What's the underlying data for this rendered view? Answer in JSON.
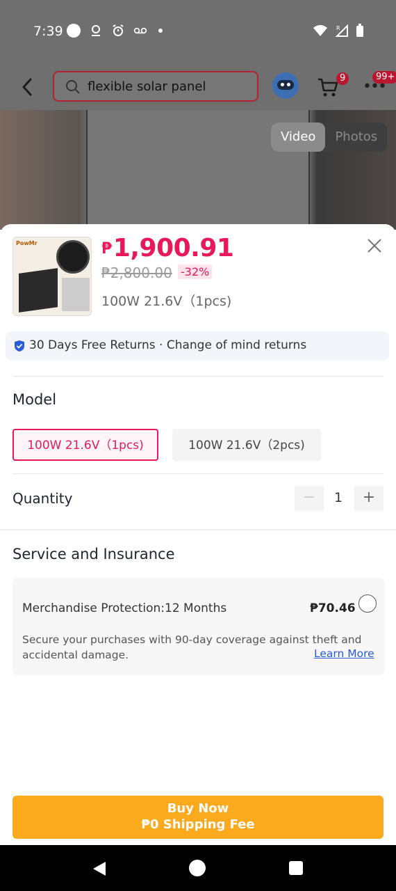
{
  "status_bar": {
    "time": "7:39"
  },
  "header": {
    "search_text": "flexible solar panel",
    "cart_badge": "9",
    "more_badge": "99+"
  },
  "media": {
    "video_label": "Video",
    "photos_label": "Photos"
  },
  "product": {
    "price_currency": "₱",
    "price_value": "1,900.91",
    "original_price": "₱2,800.00",
    "discount": "-32%",
    "selected_variant": "100W 21.6V（1pcs)",
    "thumb_brand": "PowMr"
  },
  "returns": {
    "text": "30 Days Free Returns · Change of mind returns"
  },
  "model": {
    "title": "Model",
    "options": [
      "100W 21.6V（1pcs)",
      "100W 21.6V（2pcs)"
    ],
    "selected_index": 0
  },
  "quantity": {
    "label": "Quantity",
    "minus": "−",
    "value": "1",
    "plus": "+"
  },
  "service": {
    "title": "Service and Insurance",
    "item_title": "Merchandise Protection:12 Months",
    "item_price": "₱70.46",
    "item_desc": "Secure your purchases with 90-day coverage against theft and accidental damage.",
    "learn_more": "Learn More"
  },
  "buy": {
    "line1": "Buy Now",
    "line2": "₱0 Shipping Fee"
  },
  "colors": {
    "accent": "#e8195a",
    "buy_button": "#fbaa1e",
    "link": "#2a5bd7"
  }
}
